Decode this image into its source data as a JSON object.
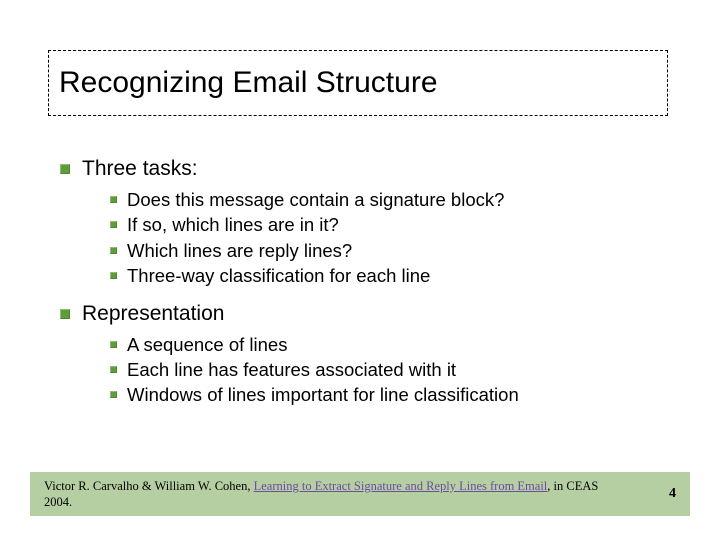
{
  "title": "Recognizing Email Structure",
  "sections": [
    {
      "heading": "Three tasks:",
      "items": [
        "Does this message contain a signature block?",
        "If so, which lines are in it?",
        "Which lines are reply lines?",
        "Three-way classification for each line"
      ]
    },
    {
      "heading": "Representation",
      "items": [
        "A sequence of lines",
        "Each line has features associated with it",
        "Windows of lines important for line classification"
      ]
    }
  ],
  "footer": {
    "authors": "Victor R. Carvalho & William W. Cohen, ",
    "paper_title": "Learning to Extract Signature and Reply Lines from Email",
    "venue": ", in CEAS 2004.",
    "page_number": "4"
  }
}
